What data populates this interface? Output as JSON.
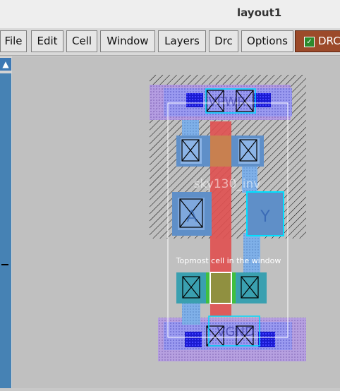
{
  "window": {
    "title": "layout1"
  },
  "menu": [
    {
      "id": "file",
      "label": "File"
    },
    {
      "id": "edit",
      "label": "Edit"
    },
    {
      "id": "cell",
      "label": "Cell"
    },
    {
      "id": "window",
      "label": "Window"
    },
    {
      "id": "layers",
      "label": "Layers"
    },
    {
      "id": "drc",
      "label": "Drc"
    },
    {
      "id": "options",
      "label": "Options"
    }
  ],
  "drc_toggle": {
    "label": "DRC",
    "checked": true
  },
  "layout": {
    "cell_label": "sky130_inv",
    "topmost_label": "Topmost cell in the window",
    "pins": {
      "vpwr": "VPWR",
      "vgnd": "VGND",
      "a": "A",
      "y": "Y"
    }
  },
  "colors": {
    "poly": "#e05050",
    "metal1": "#8080e0",
    "li": "#7fb0e8",
    "diff": "#40b0a0",
    "cyan_pin": "#00e0ff",
    "contact": "#1010d0"
  }
}
